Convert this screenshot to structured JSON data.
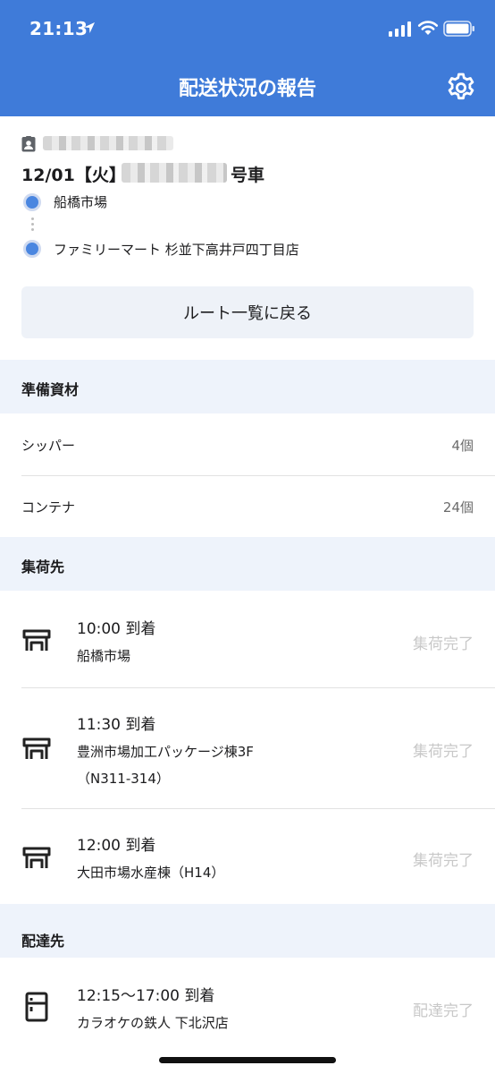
{
  "status_bar": {
    "time": "21:13"
  },
  "header": {
    "title": "配送状況の報告"
  },
  "route_card": {
    "date_label": "12/01【火】",
    "vehicle_suffix": "号車",
    "origin": "船橋市場",
    "destination": "ファミリーマート 杉並下高井戸四丁目店",
    "back_button_label": "ルート一覧に戻る"
  },
  "materials": {
    "title": "準備資材",
    "items": [
      {
        "name": "シッパー",
        "count": "4個"
      },
      {
        "name": "コンテナ",
        "count": "24個"
      }
    ]
  },
  "pickup": {
    "title": "集荷先",
    "stops": [
      {
        "time": "10:00 到着",
        "name": "船橋市場",
        "status": "集荷完了"
      },
      {
        "time": "11:30 到着",
        "name": "豊洲市場加工パッケージ棟3F",
        "name2": "（N311-314）",
        "status": "集荷完了"
      },
      {
        "time": "12:00 到着",
        "name": "大田市場水産棟（H14）",
        "status": "集荷完了"
      }
    ]
  },
  "delivery": {
    "title": "配達先",
    "stops": [
      {
        "time": "12:15〜17:00 到着",
        "name": "カラオケの鉄人 下北沢店",
        "status": "配達完了"
      }
    ]
  },
  "colors": {
    "header": "#3f7bd9",
    "section_bg": "#eef3fb",
    "route_dot": "#4a86e0",
    "done_status": "#c8c8c8"
  },
  "icons": [
    "location-arrow-icon",
    "signal-icon",
    "wifi-icon",
    "battery-icon",
    "gear-icon",
    "id-badge-icon",
    "store-icon",
    "refrigerator-icon"
  ]
}
